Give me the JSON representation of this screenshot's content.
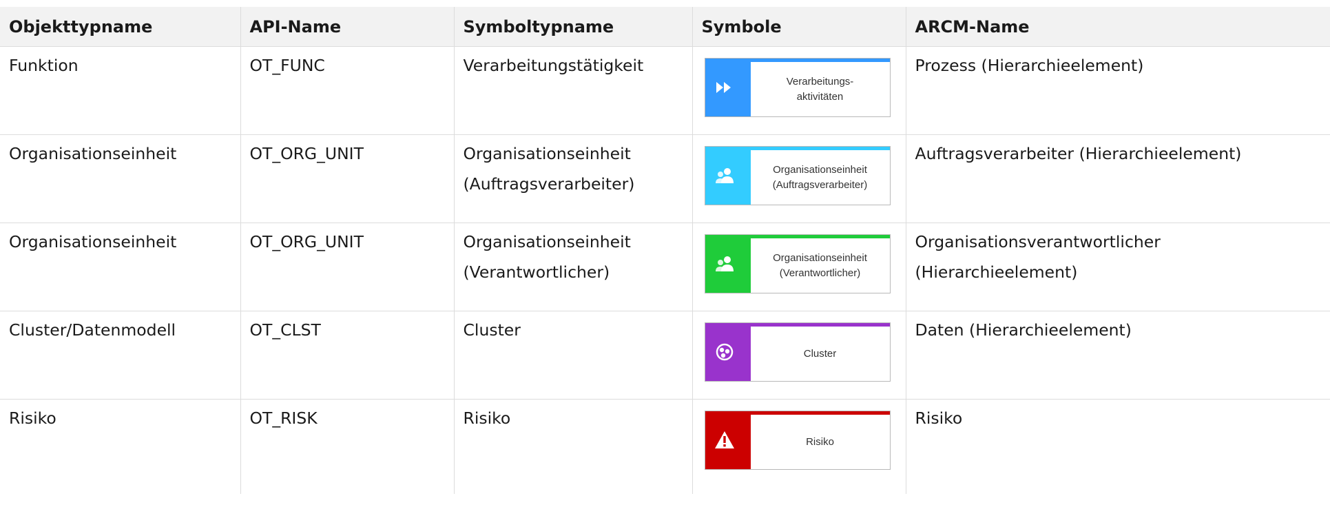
{
  "table": {
    "headers": [
      "Objekttypname",
      "API-Name",
      "Symboltypname",
      "Symbole",
      "ARCM-Name"
    ],
    "rows": [
      {
        "object_type": [
          "Funktion"
        ],
        "api_name": [
          "OT_FUNC"
        ],
        "symbol_type": [
          "Verarbeitungstätigkeit"
        ],
        "symbol": {
          "label": [
            "Verarbeitungs-",
            "aktivitäten"
          ],
          "color": "#3399ff",
          "icon": "fast-forward-icon"
        },
        "arcm_name": [
          "Prozess (Hierarchieelement)"
        ]
      },
      {
        "object_type": [
          "Organisationseinheit"
        ],
        "api_name": [
          "OT_ORG_UNIT"
        ],
        "symbol_type": [
          "Organisationseinheit",
          "(Auftragsverarbeiter)"
        ],
        "symbol": {
          "label": [
            "Organisationseinheit",
            "(Auftragsverarbeiter)"
          ],
          "color": "#33ccff",
          "icon": "people-icon"
        },
        "arcm_name": [
          "Auftragsverarbeiter (Hierarchieelement)"
        ]
      },
      {
        "object_type": [
          "Organisationseinheit"
        ],
        "api_name": [
          "OT_ORG_UNIT"
        ],
        "symbol_type": [
          "Organisationseinheit",
          "(Verantwortlicher)"
        ],
        "symbol": {
          "label": [
            "Organisationseinheit",
            "(Verantwortlicher)"
          ],
          "color": "#1fcc3a",
          "icon": "people-icon"
        },
        "arcm_name": [
          "Organisationsverantwortlicher",
          "(Hierarchieelement)"
        ]
      },
      {
        "object_type": [
          "Cluster/Datenmodell"
        ],
        "api_name": [
          "OT_CLST"
        ],
        "symbol_type": [
          "Cluster"
        ],
        "symbol": {
          "label": [
            "Cluster"
          ],
          "color": "#9933cc",
          "icon": "cluster-icon"
        },
        "arcm_name": [
          "Daten (Hierarchieelement)"
        ]
      },
      {
        "object_type": [
          "Risiko"
        ],
        "api_name": [
          "OT_RISK"
        ],
        "symbol_type": [
          "Risiko"
        ],
        "symbol": {
          "label": [
            "Risiko"
          ],
          "color": "#cc0000",
          "icon": "warning-icon"
        },
        "arcm_name": [
          "Risiko"
        ]
      }
    ]
  }
}
